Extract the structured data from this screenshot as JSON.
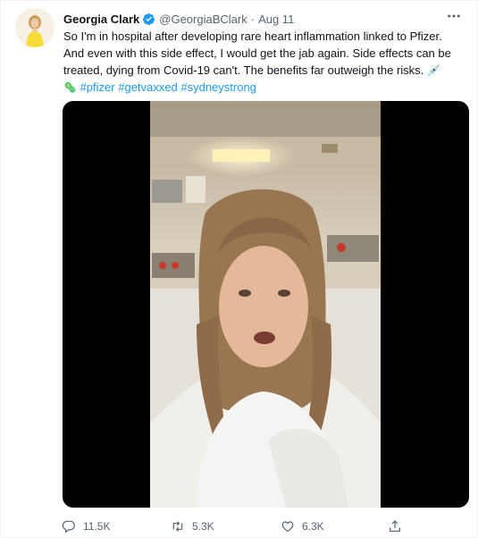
{
  "tweet": {
    "author": {
      "display_name": "Georgia Clark",
      "handle": "@GeorgiaBClark",
      "verified": true
    },
    "separator": "·",
    "date": "Aug 11",
    "text_lines": [
      "So I'm in hospital after developing rare heart inflammation linked to Pfizer.",
      "And even with this side effect, I would get the jab again. Side effects can be",
      "treated, dying from Covid-19 can't. The benefits far outweigh the risks. 💉"
    ],
    "hashtag_line_emoji": "🦠",
    "hashtags": [
      "#pfizer",
      "#getvaxxed",
      "#sydneystrong"
    ],
    "media_type": "video"
  },
  "actions": {
    "reply_count": "11.5K",
    "retweet_count": "5.3K",
    "like_count": "6.3K"
  },
  "icons": {
    "more": "more-horizontal-icon",
    "verified": "verified-badge-icon",
    "reply": "reply-icon",
    "retweet": "retweet-icon",
    "like": "like-icon",
    "share": "share-icon"
  },
  "colors": {
    "accent": "#1d9bf0",
    "text": "#0f1419",
    "secondary": "#536471",
    "media_background": "#000000"
  }
}
